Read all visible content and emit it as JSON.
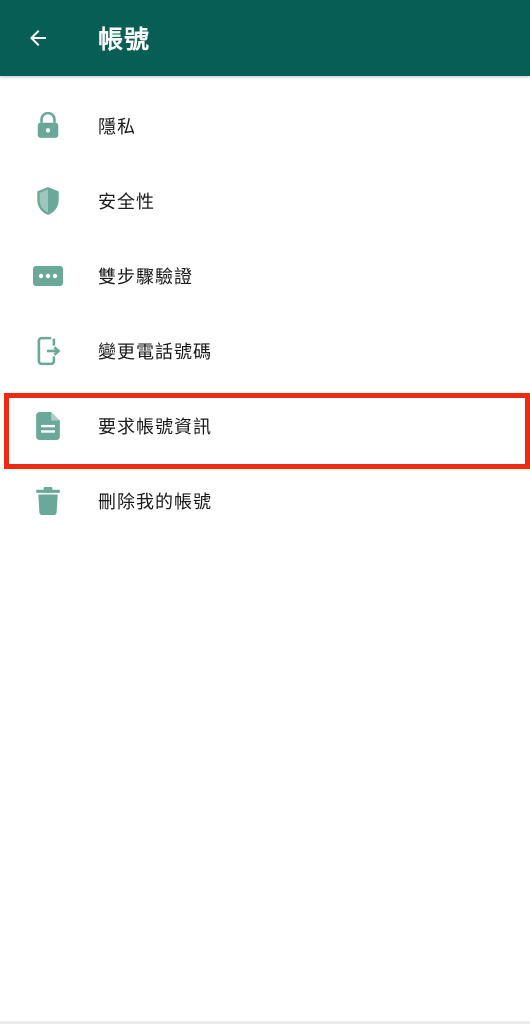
{
  "header": {
    "title": "帳號",
    "back_icon": "arrow-left-icon",
    "background": "#075e54"
  },
  "menu": {
    "icon_color": "#6aa89a",
    "highlight_color": "#ee2b12",
    "items": [
      {
        "label": "隱私",
        "icon": "lock-icon"
      },
      {
        "label": "安全性",
        "icon": "shield-icon"
      },
      {
        "label": "雙步驟驗證",
        "icon": "dots-icon"
      },
      {
        "label": "變更電話號碼",
        "icon": "phone-transfer-icon"
      },
      {
        "label": "要求帳號資訊",
        "icon": "document-icon",
        "highlighted": true
      },
      {
        "label": "刪除我的帳號",
        "icon": "trash-icon"
      }
    ]
  }
}
